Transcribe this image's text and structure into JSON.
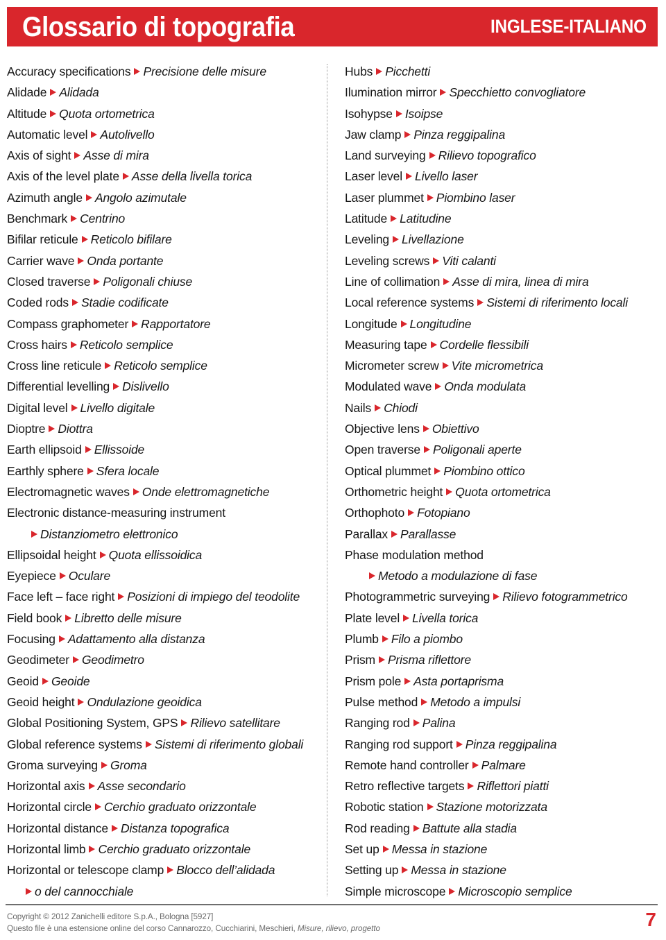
{
  "header": {
    "title": "Glossario di topografia",
    "language_label": "INGLESE-ITALIANO",
    "banner_color": "#d9262c"
  },
  "accent_color": "#d9262c",
  "separator_icon": "triangle-right-icon",
  "columns": [
    {
      "name": "left-column",
      "entries": [
        {
          "en": "Accuracy specifications",
          "it": "Precisione delle misure"
        },
        {
          "en": "Alidade",
          "it": "Alidada"
        },
        {
          "en": "Altitude",
          "it": "Quota ortometrica"
        },
        {
          "en": "Automatic level",
          "it": "Autolivello"
        },
        {
          "en": "Axis of sight",
          "it": "Asse di mira"
        },
        {
          "en": "Axis of the level plate",
          "it": "Asse della livella torica"
        },
        {
          "en": "Azimuth angle",
          "it": "Angolo azimutale"
        },
        {
          "en": "Benchmark",
          "it": "Centrino"
        },
        {
          "en": "Bifilar reticule",
          "it": "Reticolo bifilare"
        },
        {
          "en": "Carrier wave",
          "it": "Onda portante"
        },
        {
          "en": "Closed traverse",
          "it": "Poligonali chiuse"
        },
        {
          "en": "Coded rods",
          "it": "Stadie codificate"
        },
        {
          "en": "Compass graphometer",
          "it": "Rapportatore"
        },
        {
          "en": "Cross hairs",
          "it": "Reticolo semplice"
        },
        {
          "en": "Cross line reticule",
          "it": "Reticolo semplice"
        },
        {
          "en": "Differential levelling",
          "it": "Dislivello"
        },
        {
          "en": "Digital level",
          "it": "Livello digitale"
        },
        {
          "en": "Dioptre",
          "it": "Diottra"
        },
        {
          "en": "Earth ellipsoid",
          "it": "Ellissoide"
        },
        {
          "en": "Earthly sphere",
          "it": "Sfera locale"
        },
        {
          "en": "Electromagnetic waves",
          "it": "Onde elettromagnetiche"
        },
        {
          "en": "Electronic distance-measuring instrument",
          "it": "",
          "wrap": "next"
        },
        {
          "en": "",
          "it": "Distanziometro elettronico",
          "cont": true
        },
        {
          "en": "Ellipsoidal height",
          "it": "Quota ellissoidica"
        },
        {
          "en": "Eyepiece",
          "it": "Oculare"
        },
        {
          "en": "Face left – face right",
          "it": "Posizioni di impiego del teodolite"
        },
        {
          "en": "Field book",
          "it": "Libretto delle misure"
        },
        {
          "en": "Focusing",
          "it": "Adattamento alla distanza"
        },
        {
          "en": "Geodimeter",
          "it": "Geodimetro"
        },
        {
          "en": "Geoid",
          "it": "Geoide"
        },
        {
          "en": "Geoid height",
          "it": "Ondulazione geoidica"
        },
        {
          "en": "Global Positioning System, GPS",
          "it": "Rilievo satellitare"
        },
        {
          "en": "Global reference systems",
          "it": "Sistemi di riferimento globali"
        },
        {
          "en": "Groma surveying",
          "it": "Groma"
        },
        {
          "en": "Horizontal axis",
          "it": "Asse secondario"
        },
        {
          "en": "Horizontal circle",
          "it": "Cerchio graduato orizzontale"
        },
        {
          "en": "Horizontal distance",
          "it": "Distanza topografica"
        },
        {
          "en": "Horizontal limb",
          "it": "Cerchio graduato orizzontale"
        },
        {
          "en": "Horizontal or telescope clamp",
          "it": "Blocco dell’alidada"
        },
        {
          "en": "",
          "it": "o del cannocchiale",
          "cont_plain": true
        }
      ]
    },
    {
      "name": "right-column",
      "entries": [
        {
          "en": "Hubs",
          "it": "Picchetti"
        },
        {
          "en": "Ilumination mirror",
          "it": "Specchietto convogliatore"
        },
        {
          "en": "Isohypse",
          "it": "Isoipse"
        },
        {
          "en": "Jaw clamp",
          "it": "Pinza reggipalina"
        },
        {
          "en": "Land surveying",
          "it": "Rilievo topografico"
        },
        {
          "en": "Laser level",
          "it": "Livello laser"
        },
        {
          "en": "Laser plummet",
          "it": "Piombino laser"
        },
        {
          "en": "Latitude",
          "it": "Latitudine"
        },
        {
          "en": "Leveling",
          "it": "Livellazione"
        },
        {
          "en": "Leveling screws",
          "it": "Viti calanti"
        },
        {
          "en": "Line of collimation",
          "it": "Asse di mira, linea di mira"
        },
        {
          "en": "Local reference systems",
          "it": "Sistemi di riferimento locali"
        },
        {
          "en": "Longitude",
          "it": "Longitudine"
        },
        {
          "en": "Measuring tape",
          "it": "Cordelle flessibili"
        },
        {
          "en": "Micrometer screw",
          "it": "Vite micrometrica"
        },
        {
          "en": "Modulated wave",
          "it": "Onda modulata"
        },
        {
          "en": "Nails",
          "it": "Chiodi"
        },
        {
          "en": "Objective lens",
          "it": "Obiettivo"
        },
        {
          "en": "Open traverse",
          "it": "Poligonali aperte"
        },
        {
          "en": "Optical plummet",
          "it": "Piombino ottico"
        },
        {
          "en": "Orthometric height",
          "it": "Quota ortometrica"
        },
        {
          "en": "Orthophoto",
          "it": "Fotopiano"
        },
        {
          "en": "Parallax",
          "it": "Parallasse"
        },
        {
          "en": "Phase modulation method",
          "it": "",
          "wrap": "next"
        },
        {
          "en": "",
          "it": "Metodo a modulazione di fase",
          "cont": true
        },
        {
          "en": "Photogrammetric surveying",
          "it": "Rilievo fotogrammetrico"
        },
        {
          "en": "Plate level",
          "it": "Livella torica"
        },
        {
          "en": "Plumb",
          "it": "Filo a piombo"
        },
        {
          "en": "Prism",
          "it": "Prisma riflettore"
        },
        {
          "en": "Prism pole",
          "it": "Asta portaprisma"
        },
        {
          "en": "Pulse method",
          "it": "Metodo a impulsi"
        },
        {
          "en": "Ranging rod",
          "it": "Palina"
        },
        {
          "en": "Ranging rod support",
          "it": "Pinza reggipalina"
        },
        {
          "en": "Remote hand controller",
          "it": "Palmare"
        },
        {
          "en": "Retro reflective targets",
          "it": "Riflettori piatti"
        },
        {
          "en": "Robotic station",
          "it": "Stazione motorizzata"
        },
        {
          "en": "Rod reading",
          "it": "Battute alla stadia"
        },
        {
          "en": "Set up",
          "it": "Messa in stazione"
        },
        {
          "en": "Setting up",
          "it": "Messa in stazione"
        },
        {
          "en": "Simple microscope",
          "it": "Microscopio semplice"
        }
      ]
    }
  ],
  "footer": {
    "line1": "Copyright © 2012 Zanichelli editore S.p.A., Bologna [5927]",
    "line2_prefix": "Questo file è una estensione online del corso Cannarozzo, Cucchiarini, Meschieri, ",
    "line2_italic": "Misure, rilievo, progetto",
    "page_number": "7"
  }
}
